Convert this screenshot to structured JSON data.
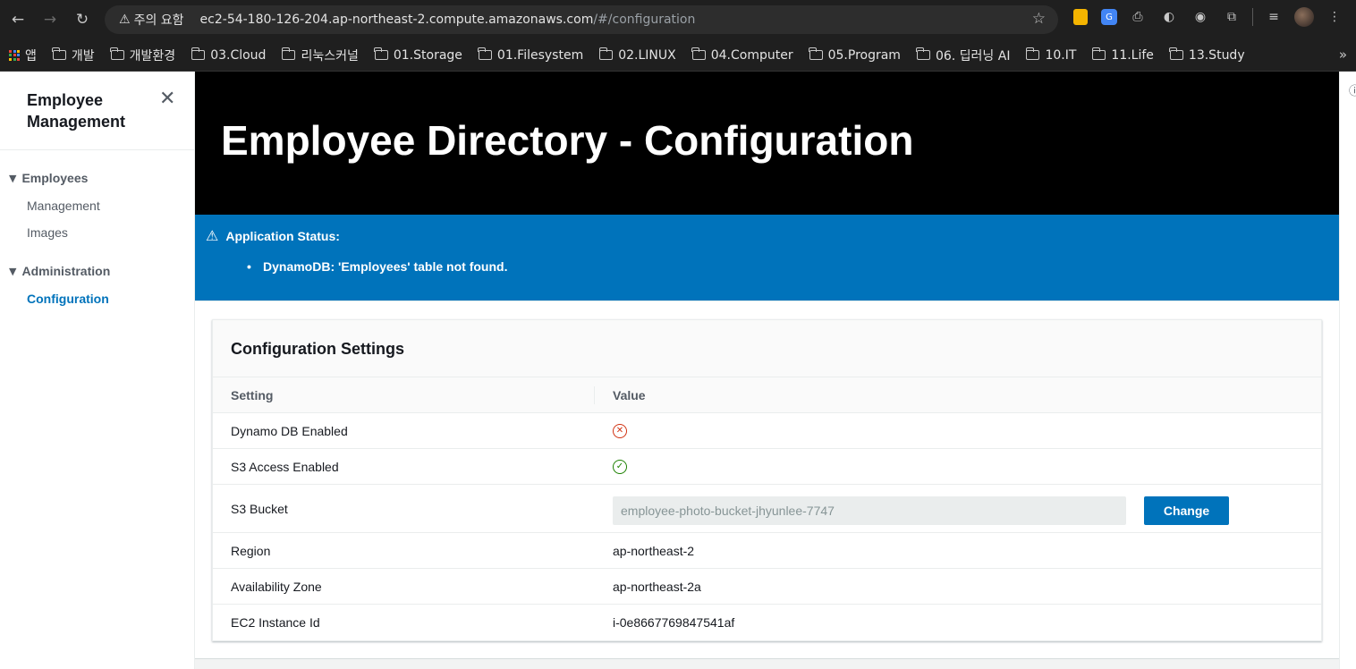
{
  "browser": {
    "security_label": "주의 요함",
    "url_host": "ec2-54-180-126-204.ap-northeast-2.compute.amazonaws.com",
    "url_path": "/#/configuration"
  },
  "bookmarks": {
    "apps_label": "앱",
    "items": [
      "개발",
      "개발환경",
      "03.Cloud",
      "리눅스커널",
      "01.Storage",
      "01.Filesystem",
      "02.LINUX",
      "04.Computer",
      "05.Program",
      "06. 딥러닝 AI",
      "10.IT",
      "11.Life",
      "13.Study"
    ]
  },
  "sidebar": {
    "title": "Employee Management",
    "sections": [
      {
        "label": "Employees",
        "items": [
          "Management",
          "Images"
        ]
      },
      {
        "label": "Administration",
        "items": [
          "Configuration"
        ]
      }
    ]
  },
  "header": {
    "title": "Employee Directory - Configuration"
  },
  "alert": {
    "title": "Application Status:",
    "message": "DynamoDB: 'Employees' table not found."
  },
  "config": {
    "title": "Configuration Settings",
    "col_setting": "Setting",
    "col_value": "Value",
    "rows": {
      "dynamo": {
        "label": "Dynamo DB Enabled",
        "enabled": false
      },
      "s3": {
        "label": "S3 Access Enabled",
        "enabled": true
      },
      "bucket": {
        "label": "S3 Bucket",
        "value": "employee-photo-bucket-jhyunlee-7747",
        "button": "Change"
      },
      "region": {
        "label": "Region",
        "value": "ap-northeast-2"
      },
      "az": {
        "label": "Availability Zone",
        "value": "ap-northeast-2a"
      },
      "instance": {
        "label": "EC2 Instance Id",
        "value": "i-0e8667769847541af"
      }
    }
  },
  "colors": {
    "accent": "#0073bb",
    "error": "#d13212",
    "success": "#1d8102",
    "hero_bg": "#000000"
  }
}
